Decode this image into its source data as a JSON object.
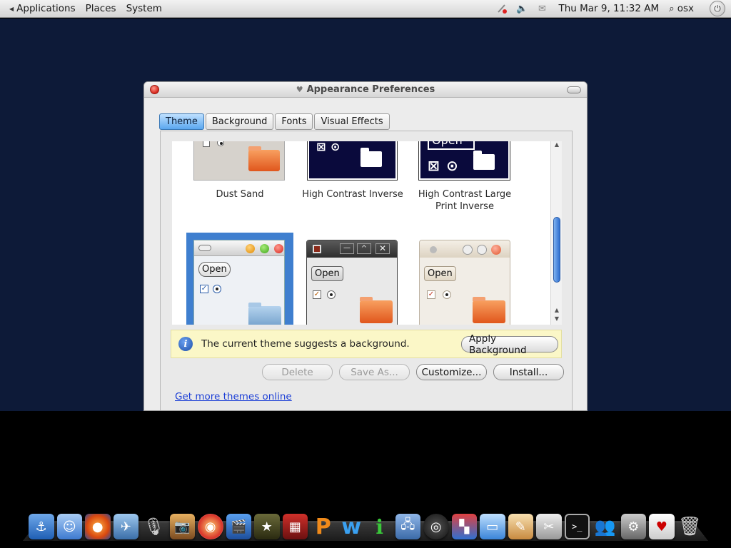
{
  "top_panel": {
    "menus": [
      "Applications",
      "Places",
      "System"
    ],
    "clock": "Thu Mar  9, 11:32 AM",
    "user": "osx",
    "tray_icons": [
      "network-offline-icon",
      "volume-icon",
      "mail-icon"
    ]
  },
  "window": {
    "title": "Appearance Preferences",
    "tabs": [
      {
        "label": "Theme",
        "active": true
      },
      {
        "label": "Background",
        "active": false
      },
      {
        "label": "Fonts",
        "active": false
      },
      {
        "label": "Visual Effects",
        "active": false
      }
    ],
    "themes": [
      {
        "name": "Dust Sand",
        "selected": false
      },
      {
        "name": "High Contrast Inverse",
        "selected": false
      },
      {
        "name": "High Contrast Large Print Inverse",
        "selected": false
      },
      {
        "name": "",
        "selected": true
      },
      {
        "name": "",
        "selected": false
      },
      {
        "name": "",
        "selected": false
      }
    ],
    "preview_button_label": "Open",
    "preview_button_label_hc": "Open",
    "info": {
      "text": "The current theme suggests a background.",
      "apply_button": "Apply Background"
    },
    "buttons": {
      "delete": "Delete",
      "save_as": "Save As...",
      "customize": "Customize...",
      "install": "Install..."
    },
    "more_themes_link": "Get more themes online"
  },
  "dock": {
    "icons": [
      "finder-anchor-icon",
      "finder-icon",
      "firefox-icon",
      "preview-icon",
      "microphone-icon",
      "iphoto-icon",
      "photo-booth-icon",
      "imovie-icon",
      "star-icon",
      "photo-album-icon",
      "pages-icon",
      "word-icon",
      "numbers-icon",
      "network-icon",
      "speaker-icon",
      "blocks-icon",
      "remote-desktop-icon",
      "text-edit-icon",
      "script-editor-icon",
      "terminal-icon",
      "users-icon",
      "system-preferences-icon",
      "game-cards-icon",
      "trash-icon"
    ]
  },
  "colors": {
    "desktop": "#0d1a38",
    "selected_theme": "#3f7fcf",
    "active_tab": "#5aa7ef",
    "info_bar": "#fbf7c7",
    "link": "#1b3ed6"
  }
}
